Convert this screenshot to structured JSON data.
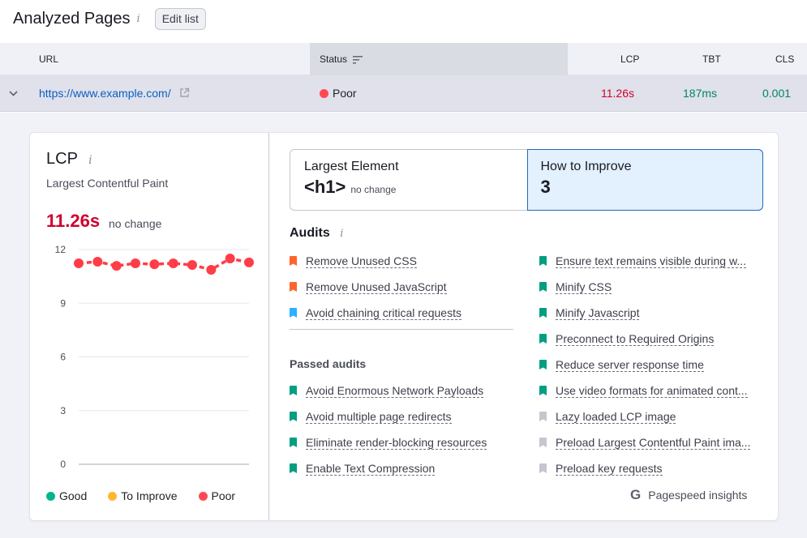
{
  "header": {
    "title": "Analyzed Pages",
    "info_icon": "i",
    "edit_button": "Edit list"
  },
  "table": {
    "columns": {
      "url": "URL",
      "status": "Status",
      "lcp": "LCP",
      "tbt": "TBT",
      "cls": "CLS"
    },
    "row": {
      "url": "https://www.example.com/",
      "status": "Poor",
      "lcp": "11.26s",
      "tbt": "187ms",
      "cls": "0.001"
    }
  },
  "colors": {
    "poor": "#ff4953",
    "good": "#009f81",
    "to_improve": "#ffb031",
    "lcp_red": "#d1002f",
    "metric_green": "#00875f",
    "accent_blue": "#1f6ab8"
  },
  "metric": {
    "title": "LCP",
    "info_icon": "i",
    "subtitle": "Largest Contentful Paint",
    "value": "11.26s",
    "change": "no change"
  },
  "legend": [
    {
      "label": "Good",
      "color": "#00b58c"
    },
    {
      "label": "To Improve",
      "color": "#ffb82e"
    },
    {
      "label": "Poor",
      "color": "#ff4953"
    }
  ],
  "chart_data": {
    "type": "line",
    "title": "",
    "xlabel": "",
    "ylabel": "",
    "ylim": [
      0,
      12
    ],
    "yticks": [
      "0",
      "3",
      "6",
      "9",
      "12"
    ],
    "grid": true,
    "series": [
      {
        "name": "LCP",
        "color": "#ff3d47",
        "values": [
          11.23,
          11.32,
          11.09,
          11.23,
          11.18,
          11.23,
          11.14,
          10.87,
          11.5,
          11.28
        ]
      }
    ]
  },
  "tiles": {
    "largest_element": {
      "label": "Largest Element",
      "value": "<h1>",
      "change": "no change"
    },
    "how_to_improve": {
      "label": "How to Improve",
      "value": "3"
    }
  },
  "audits": {
    "title": "Audits",
    "info_icon": "i",
    "failing": [
      {
        "label": "Remove Unused CSS",
        "color": "#ff642d"
      },
      {
        "label": "Remove Unused JavaScript",
        "color": "#ff642d"
      },
      {
        "label": "Avoid chaining critical requests",
        "color": "#2bb1ff"
      }
    ],
    "passed_title": "Passed audits",
    "passed_left": [
      "Avoid Enormous Network Payloads",
      "Avoid multiple page redirects",
      "Eliminate render-blocking resources",
      "Enable Text Compression"
    ],
    "right": [
      {
        "label": "Ensure text remains visible during w...",
        "color": "#009f81"
      },
      {
        "label": "Minify CSS",
        "color": "#009f81"
      },
      {
        "label": "Minify Javascript",
        "color": "#009f81"
      },
      {
        "label": "Preconnect to Required Origins",
        "color": "#009f81"
      },
      {
        "label": "Reduce server response time",
        "color": "#009f81"
      },
      {
        "label": "Use video formats for animated cont...",
        "color": "#009f81"
      },
      {
        "label": "Lazy loaded LCP image",
        "color": "#c4c7cf"
      },
      {
        "label": "Preload Largest Contentful Paint ima...",
        "color": "#c4c7cf"
      },
      {
        "label": "Preload key requests",
        "color": "#c4c7cf"
      }
    ],
    "pagespeed_icon": "G",
    "pagespeed_label": "Pagespeed insights"
  }
}
